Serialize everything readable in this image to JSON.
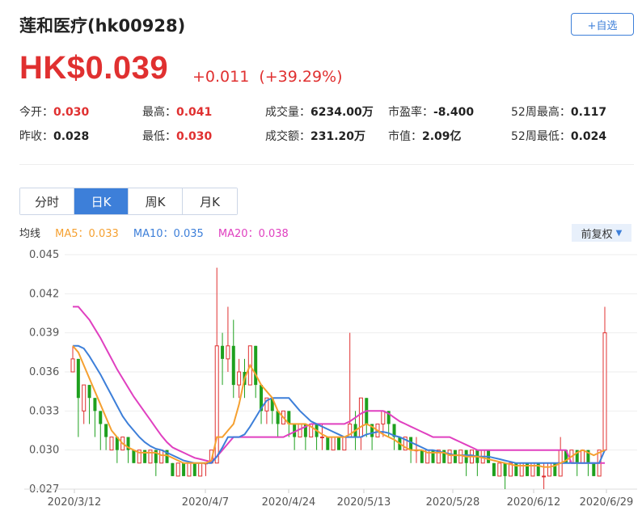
{
  "header": {
    "title": "莲和医疗(hk00928)",
    "watch_label": "+自选",
    "price": "HK$0.039",
    "change": "+0.011",
    "change_pct": "(+39.29%)"
  },
  "stats": {
    "row1": [
      {
        "label": "今开：",
        "value": "0.030",
        "color": "red"
      },
      {
        "label": "最高：",
        "value": "0.041",
        "color": "red"
      },
      {
        "label": "成交量：",
        "value": "6234.00万",
        "color": "dark"
      },
      {
        "label": "市盈率：",
        "value": "-8.400",
        "color": "dark"
      },
      {
        "label": "52周最高：",
        "value": "0.117",
        "color": "dark"
      }
    ],
    "row2": [
      {
        "label": "昨收：",
        "value": "0.028",
        "color": "dark"
      },
      {
        "label": "最低：",
        "value": "0.030",
        "color": "red"
      },
      {
        "label": "成交额：",
        "value": "231.20万",
        "color": "dark"
      },
      {
        "label": "市值：",
        "value": "2.09亿",
        "color": "dark"
      },
      {
        "label": "52周最低：",
        "value": "0.024",
        "color": "dark"
      }
    ]
  },
  "tabs": [
    "分时",
    "日K",
    "周K",
    "月K"
  ],
  "active_tab": "日K",
  "ma": {
    "label": "均线",
    "ma5": "MA5：0.033",
    "ma10": "MA10：0.035",
    "ma20": "MA20：0.038"
  },
  "adjust_label": "前复权",
  "colors": {
    "up": "#e03030",
    "down": "#1ea01e",
    "ma5": "#f5a030",
    "ma10": "#3d7fd9",
    "ma20": "#e040c0",
    "accent": "#3d7fd9"
  },
  "chart_data": {
    "type": "candlestick",
    "y_ticks": [
      "0.045",
      "0.042",
      "0.039",
      "0.036",
      "0.033",
      "0.030",
      "0.027"
    ],
    "ylim": [
      0.027,
      0.045
    ],
    "x_ticks": [
      "2020/3/12",
      "2020/4/7",
      "2020/4/24",
      "2020/5/13",
      "2020/5/28",
      "2020/6/12",
      "2020/6/29"
    ],
    "grid": true,
    "candles": [
      [
        0.036,
        0.037,
        0.038,
        0.036
      ],
      [
        0.037,
        0.034,
        0.037,
        0.031
      ],
      [
        0.033,
        0.035,
        0.035,
        0.032
      ],
      [
        0.035,
        0.034,
        0.035,
        0.032
      ],
      [
        0.034,
        0.033,
        0.034,
        0.031
      ],
      [
        0.033,
        0.032,
        0.033,
        0.03
      ],
      [
        0.032,
        0.031,
        0.032,
        0.03
      ],
      [
        0.03,
        0.031,
        0.031,
        0.03
      ],
      [
        0.031,
        0.03,
        0.031,
        0.029
      ],
      [
        0.03,
        0.031,
        0.031,
        0.03
      ],
      [
        0.031,
        0.03,
        0.031,
        0.029
      ],
      [
        0.03,
        0.029,
        0.03,
        0.029
      ],
      [
        0.029,
        0.03,
        0.03,
        0.029
      ],
      [
        0.03,
        0.029,
        0.03,
        0.029
      ],
      [
        0.029,
        0.03,
        0.03,
        0.029
      ],
      [
        0.03,
        0.029,
        0.03,
        0.028
      ],
      [
        0.029,
        0.03,
        0.03,
        0.029
      ],
      [
        0.03,
        0.029,
        0.03,
        0.029
      ],
      [
        0.029,
        0.028,
        0.029,
        0.028
      ],
      [
        0.028,
        0.029,
        0.029,
        0.028
      ],
      [
        0.029,
        0.028,
        0.029,
        0.028
      ],
      [
        0.028,
        0.029,
        0.029,
        0.028
      ],
      [
        0.029,
        0.028,
        0.029,
        0.028
      ],
      [
        0.028,
        0.029,
        0.029,
        0.028
      ],
      [
        0.029,
        0.029,
        0.029,
        0.028
      ],
      [
        0.029,
        0.03,
        0.03,
        0.029
      ],
      [
        0.029,
        0.038,
        0.044,
        0.029
      ],
      [
        0.038,
        0.037,
        0.039,
        0.035
      ],
      [
        0.037,
        0.038,
        0.041,
        0.036
      ],
      [
        0.038,
        0.035,
        0.04,
        0.034
      ],
      [
        0.035,
        0.036,
        0.037,
        0.034
      ],
      [
        0.036,
        0.035,
        0.037,
        0.034
      ],
      [
        0.035,
        0.038,
        0.038,
        0.035
      ],
      [
        0.038,
        0.035,
        0.038,
        0.034
      ],
      [
        0.035,
        0.033,
        0.035,
        0.032
      ],
      [
        0.033,
        0.034,
        0.034,
        0.032
      ],
      [
        0.034,
        0.033,
        0.034,
        0.032
      ],
      [
        0.033,
        0.032,
        0.033,
        0.031
      ],
      [
        0.032,
        0.033,
        0.033,
        0.032
      ],
      [
        0.033,
        0.032,
        0.033,
        0.031
      ],
      [
        0.032,
        0.031,
        0.032,
        0.03
      ],
      [
        0.031,
        0.032,
        0.032,
        0.031
      ],
      [
        0.032,
        0.031,
        0.032,
        0.03
      ],
      [
        0.031,
        0.032,
        0.032,
        0.031
      ],
      [
        0.032,
        0.031,
        0.032,
        0.03
      ],
      [
        0.031,
        0.031,
        0.032,
        0.03
      ],
      [
        0.031,
        0.03,
        0.031,
        0.03
      ],
      [
        0.03,
        0.031,
        0.031,
        0.03
      ],
      [
        0.031,
        0.03,
        0.031,
        0.03
      ],
      [
        0.03,
        0.031,
        0.031,
        0.03
      ],
      [
        0.031,
        0.032,
        0.039,
        0.031
      ],
      [
        0.032,
        0.031,
        0.033,
        0.03
      ],
      [
        0.031,
        0.034,
        0.034,
        0.03
      ],
      [
        0.034,
        0.032,
        0.034,
        0.031
      ],
      [
        0.032,
        0.031,
        0.032,
        0.03
      ],
      [
        0.031,
        0.032,
        0.032,
        0.031
      ],
      [
        0.032,
        0.033,
        0.033,
        0.031
      ],
      [
        0.033,
        0.032,
        0.033,
        0.031
      ],
      [
        0.032,
        0.031,
        0.032,
        0.03
      ],
      [
        0.031,
        0.03,
        0.031,
        0.03
      ],
      [
        0.03,
        0.031,
        0.031,
        0.03
      ],
      [
        0.031,
        0.03,
        0.031,
        0.029
      ],
      [
        0.03,
        0.03,
        0.031,
        0.029
      ],
      [
        0.03,
        0.029,
        0.03,
        0.029
      ],
      [
        0.029,
        0.03,
        0.03,
        0.029
      ],
      [
        0.03,
        0.029,
        0.03,
        0.029
      ],
      [
        0.029,
        0.03,
        0.03,
        0.029
      ],
      [
        0.03,
        0.029,
        0.03,
        0.029
      ],
      [
        0.029,
        0.03,
        0.03,
        0.029
      ],
      [
        0.03,
        0.029,
        0.03,
        0.029
      ],
      [
        0.029,
        0.03,
        0.03,
        0.029
      ],
      [
        0.03,
        0.029,
        0.03,
        0.028
      ],
      [
        0.029,
        0.03,
        0.03,
        0.029
      ],
      [
        0.03,
        0.029,
        0.03,
        0.028
      ],
      [
        0.029,
        0.03,
        0.03,
        0.029
      ],
      [
        0.03,
        0.029,
        0.03,
        0.029
      ],
      [
        0.029,
        0.028,
        0.029,
        0.028
      ],
      [
        0.028,
        0.029,
        0.029,
        0.028
      ],
      [
        0.029,
        0.028,
        0.029,
        0.027
      ],
      [
        0.028,
        0.029,
        0.029,
        0.028
      ],
      [
        0.029,
        0.028,
        0.029,
        0.028
      ],
      [
        0.028,
        0.029,
        0.029,
        0.028
      ],
      [
        0.029,
        0.028,
        0.029,
        0.028
      ],
      [
        0.028,
        0.029,
        0.029,
        0.028
      ],
      [
        0.029,
        0.028,
        0.029,
        0.028
      ],
      [
        0.028,
        0.028,
        0.029,
        0.027
      ],
      [
        0.028,
        0.029,
        0.029,
        0.028
      ],
      [
        0.029,
        0.028,
        0.029,
        0.028
      ],
      [
        0.028,
        0.03,
        0.031,
        0.028
      ],
      [
        0.03,
        0.029,
        0.03,
        0.029
      ],
      [
        0.029,
        0.03,
        0.03,
        0.029
      ],
      [
        0.03,
        0.029,
        0.03,
        0.028
      ],
      [
        0.029,
        0.03,
        0.03,
        0.029
      ],
      [
        0.03,
        0.029,
        0.03,
        0.028
      ],
      [
        0.029,
        0.028,
        0.029,
        0.028
      ],
      [
        0.028,
        0.03,
        0.03,
        0.028
      ],
      [
        0.03,
        0.039,
        0.041,
        0.03
      ]
    ],
    "ma5": [
      0.038,
      0.0375,
      0.0365,
      0.0355,
      0.0345,
      0.0335,
      0.0325,
      0.0315,
      0.031,
      0.0305,
      0.0302,
      0.03,
      0.0298,
      0.0298,
      0.0298,
      0.0298,
      0.0296,
      0.0296,
      0.0294,
      0.0292,
      0.029,
      0.029,
      0.029,
      0.029,
      0.029,
      0.0292,
      0.031,
      0.031,
      0.0315,
      0.032,
      0.0335,
      0.0355,
      0.0365,
      0.0358,
      0.035,
      0.0345,
      0.034,
      0.033,
      0.0325,
      0.032,
      0.032,
      0.032,
      0.032,
      0.0318,
      0.0315,
      0.0312,
      0.031,
      0.031,
      0.031,
      0.031,
      0.0312,
      0.0315,
      0.0318,
      0.032,
      0.0318,
      0.0315,
      0.0312,
      0.031,
      0.0308,
      0.0305,
      0.0302,
      0.03,
      0.03,
      0.03,
      0.0298,
      0.0298,
      0.0298,
      0.0298,
      0.0296,
      0.0296,
      0.0296,
      0.0295,
      0.0295,
      0.0295,
      0.0294,
      0.0293,
      0.0292,
      0.0291,
      0.029,
      0.0289,
      0.0288,
      0.0288,
      0.0288,
      0.0288,
      0.0288,
      0.0287,
      0.0287,
      0.0288,
      0.029,
      0.0292,
      0.0295,
      0.0298,
      0.03,
      0.0298,
      0.0296,
      0.0298,
      0.03
    ],
    "ma10": [
      0.038,
      0.038,
      0.0378,
      0.0372,
      0.0365,
      0.0358,
      0.035,
      0.0342,
      0.0334,
      0.0326,
      0.032,
      0.0315,
      0.031,
      0.0306,
      0.0303,
      0.0301,
      0.03,
      0.0298,
      0.0296,
      0.0294,
      0.0292,
      0.0291,
      0.029,
      0.029,
      0.029,
      0.029,
      0.0295,
      0.0302,
      0.031,
      0.031,
      0.031,
      0.0312,
      0.0318,
      0.0325,
      0.0332,
      0.0338,
      0.034,
      0.034,
      0.034,
      0.034,
      0.0335,
      0.033,
      0.0326,
      0.0322,
      0.032,
      0.0318,
      0.0316,
      0.0314,
      0.0312,
      0.031,
      0.031,
      0.031,
      0.031,
      0.0312,
      0.0313,
      0.0314,
      0.0314,
      0.0313,
      0.0311,
      0.031,
      0.0308,
      0.0306,
      0.0304,
      0.0302,
      0.03,
      0.03,
      0.0299,
      0.0298,
      0.0297,
      0.0296,
      0.0296,
      0.0296,
      0.0296,
      0.0295,
      0.0295,
      0.0295,
      0.0294,
      0.0293,
      0.0292,
      0.0291,
      0.029,
      0.029,
      0.029,
      0.029,
      0.029,
      0.029,
      0.029,
      0.029,
      0.029,
      0.029,
      0.029,
      0.029,
      0.029,
      0.029,
      0.029,
      0.029,
      0.03
    ],
    "ma20": [
      0.041,
      0.041,
      0.0405,
      0.04,
      0.0393,
      0.0386,
      0.0378,
      0.037,
      0.0362,
      0.0355,
      0.0348,
      0.0341,
      0.0335,
      0.0329,
      0.0323,
      0.0317,
      0.0311,
      0.0306,
      0.0302,
      0.03,
      0.0298,
      0.0296,
      0.0294,
      0.0293,
      0.0292,
      0.0291,
      0.0295,
      0.03,
      0.0305,
      0.031,
      0.031,
      0.031,
      0.031,
      0.031,
      0.031,
      0.031,
      0.031,
      0.031,
      0.031,
      0.0312,
      0.0314,
      0.0316,
      0.0318,
      0.032,
      0.032,
      0.032,
      0.032,
      0.032,
      0.032,
      0.032,
      0.0322,
      0.0325,
      0.0328,
      0.033,
      0.033,
      0.033,
      0.033,
      0.0328,
      0.0325,
      0.0322,
      0.032,
      0.0318,
      0.0316,
      0.0314,
      0.0312,
      0.031,
      0.031,
      0.031,
      0.031,
      0.0308,
      0.0306,
      0.0304,
      0.0302,
      0.03,
      0.03,
      0.03,
      0.03,
      0.03,
      0.03,
      0.03,
      0.03,
      0.03,
      0.03,
      0.03,
      0.03,
      0.03,
      0.03,
      0.03,
      0.03,
      0.03,
      0.029,
      0.029,
      0.029,
      0.029,
      0.029,
      0.029,
      0.029
    ]
  }
}
